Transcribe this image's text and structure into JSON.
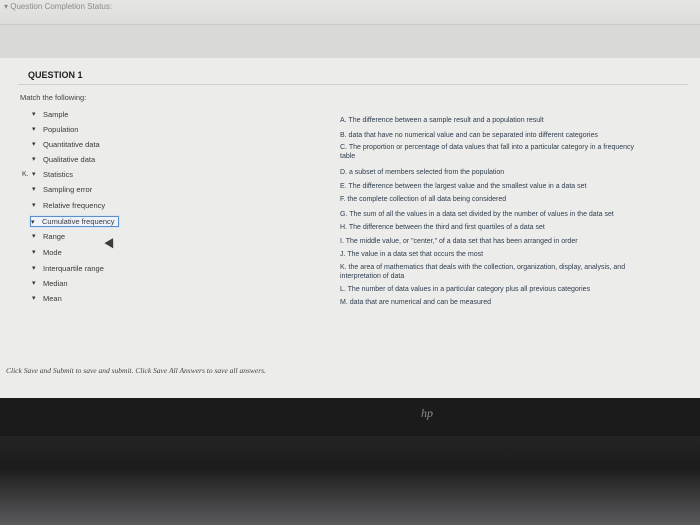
{
  "status_bar": {
    "label": "Question Completion Status:"
  },
  "question": {
    "title": "QUESTION 1",
    "instruction": "Match the following:"
  },
  "left_items": [
    {
      "answer": "",
      "label": "Sample"
    },
    {
      "answer": "",
      "label": "Population"
    },
    {
      "answer": "",
      "label": "Quantitative data"
    },
    {
      "answer": "",
      "label": "Qualitative data"
    },
    {
      "answer": "K.",
      "label": "Statistics"
    },
    {
      "answer": "",
      "label": "Sampling error"
    },
    {
      "answer": "",
      "label": "Relative frequency"
    },
    {
      "answer": "",
      "label": "Cumulative frequency"
    },
    {
      "answer": "",
      "label": "Range"
    },
    {
      "answer": "",
      "label": "Mode"
    },
    {
      "answer": "",
      "label": "Interquartile range"
    },
    {
      "answer": "",
      "label": "Median"
    },
    {
      "answer": "",
      "label": "Mean"
    }
  ],
  "right_items": [
    "A. The difference between a sample result and a population result",
    "B. data that have no numerical value and can be separated into different categories",
    "C. The proportion or percentage of data values that fall into a particular category in a frequency table",
    "D. a subset of members selected from the population",
    "E. The difference between the largest value and the smallest value in a data set",
    "F. the complete collection of all data being considered",
    "G. The sum of all the values in a data set divided by the number of values in the data set",
    "H. The difference between the third and first quartiles of a data set",
    "I. The middle value, or \"center,\" of a data set that has been arranged in order",
    "J. The value in a data set that occurs the most",
    "K. the area of mathematics that deals with the collection, organization, display, analysis, and interpretation of data",
    "L. The number of data values in a particular category plus all previous categories",
    "M. data that are numerical and can be measured"
  ],
  "footer": {
    "note": "Click Save and Submit to save and submit. Click Save All Answers to save all answers."
  },
  "device": {
    "logo": "hp"
  }
}
